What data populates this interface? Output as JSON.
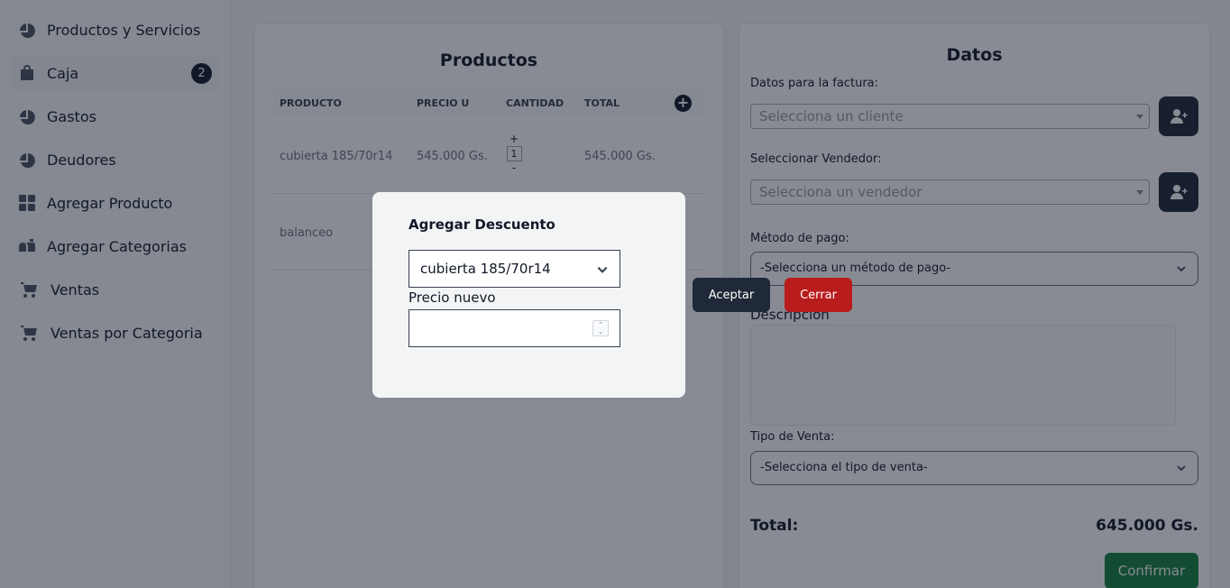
{
  "sidebar": {
    "items": [
      {
        "label": "Productos y Servicios",
        "icon": "pie-chart-icon"
      },
      {
        "label": "Caja",
        "icon": "shopping-bag-icon",
        "badge": "2"
      },
      {
        "label": "Gastos",
        "icon": "pie-chart-icon"
      },
      {
        "label": "Deudores",
        "icon": "pie-chart-icon"
      },
      {
        "label": "Agregar Producto",
        "icon": "grid-icon"
      },
      {
        "label": "Agregar Categorias",
        "icon": "mailbox-icon"
      },
      {
        "label": "Ventas",
        "icon": "cart-icon"
      },
      {
        "label": "Ventas por Categoria",
        "icon": "cart-icon"
      }
    ]
  },
  "products": {
    "title": "Productos",
    "columns": [
      "PRODUCTO",
      "PRECIO U",
      "CANTIDAD",
      "TOTAL"
    ],
    "rows": [
      {
        "name": "cubierta 185/70r14",
        "price": "545.000 Gs.",
        "qty": "1",
        "total": "545.000 Gs."
      },
      {
        "name": "balanceo"
      }
    ],
    "plus": "+",
    "minus": "-"
  },
  "datos": {
    "title": "Datos",
    "factura_label": "Datos para la factura:",
    "cliente_placeholder": "Selecciona un cliente",
    "vendedor_label": "Seleccionar Vendedor:",
    "vendedor_placeholder": "Selecciona un vendedor",
    "metodo_label": "Método de pago:",
    "metodo_value": "-Selecciona un método de pago-",
    "descripcion_label": "Descripcion",
    "tipo_label": "Tipo de Venta:",
    "tipo_value": "-Selecciona el tipo de venta-",
    "total_label": "Total:",
    "total_value": "645.000 Gs.",
    "confirm_label": "Confirmar"
  },
  "modal": {
    "title": "Agregar Descuento",
    "product_selected": "cubierta 185/70r14",
    "price_label": "Precio nuevo",
    "price_value": "",
    "accept_label": "Aceptar",
    "close_label": "Cerrar"
  }
}
